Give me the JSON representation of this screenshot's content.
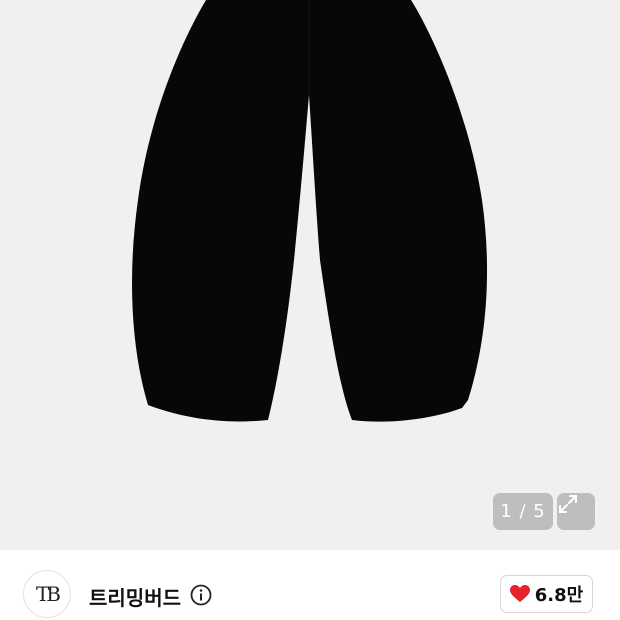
{
  "gallery": {
    "current_page": "1",
    "separator": "/",
    "total_pages": "5",
    "counter_text": "1 / 5"
  },
  "seller": {
    "avatar_text": "TB",
    "name": "트리밍버드"
  },
  "like": {
    "count": "6.8만",
    "heart_color": "#e8212f"
  },
  "icons": {
    "expand": "expand-arrows-icon",
    "info": "info-icon",
    "heart": "heart-icon"
  }
}
